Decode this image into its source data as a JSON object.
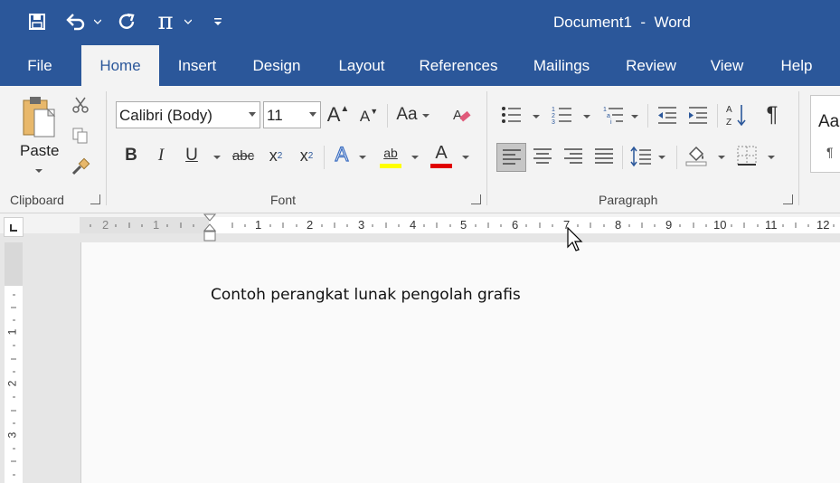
{
  "window": {
    "title": "Document1  -  Word"
  },
  "quick_access": {
    "save_icon": "save-icon",
    "undo_icon": "undo-icon",
    "redo_icon": "redo-icon",
    "equation_glyph": "π",
    "customize_icon": "customize-qat-icon"
  },
  "tabs": [
    {
      "label": "File"
    },
    {
      "label": "Home"
    },
    {
      "label": "Insert"
    },
    {
      "label": "Design"
    },
    {
      "label": "Layout"
    },
    {
      "label": "References"
    },
    {
      "label": "Mailings"
    },
    {
      "label": "Review"
    },
    {
      "label": "View"
    },
    {
      "label": "Help"
    }
  ],
  "clipboard": {
    "paste_label": "Paste",
    "group_label": "Clipboard"
  },
  "font": {
    "name": "Calibri (Body)",
    "size": "11",
    "bold": "B",
    "italic": "I",
    "underline": "U",
    "strike": "abc",
    "subscript": "x",
    "subscript_mark": "2",
    "superscript": "x",
    "superscript_mark": "2",
    "case": "Aa",
    "grow": "A",
    "shrink": "A",
    "effects": "A",
    "highlight": "ab",
    "font_color": "A",
    "group_label": "Font",
    "highlight_color": "#ffff00",
    "font_color_value": "#e00000"
  },
  "paragraph": {
    "group_label": "Paragraph",
    "pilcrow": "¶",
    "sort": "A Z"
  },
  "styles": {
    "preview": "Aa",
    "pilcrow": "¶"
  },
  "ruler": {
    "horizontal_numbers": [
      "2",
      "1",
      "1",
      "2",
      "3",
      "4",
      "5",
      "6",
      "7",
      "8",
      "9",
      "10",
      "11",
      "12"
    ],
    "vertical_numbers": [
      "1",
      "2",
      "3"
    ]
  },
  "document": {
    "text": "Contoh perangkat lunak pengolah grafis"
  },
  "colors": {
    "accent": "#2b579a",
    "ribbon": "#f3f3f3"
  }
}
